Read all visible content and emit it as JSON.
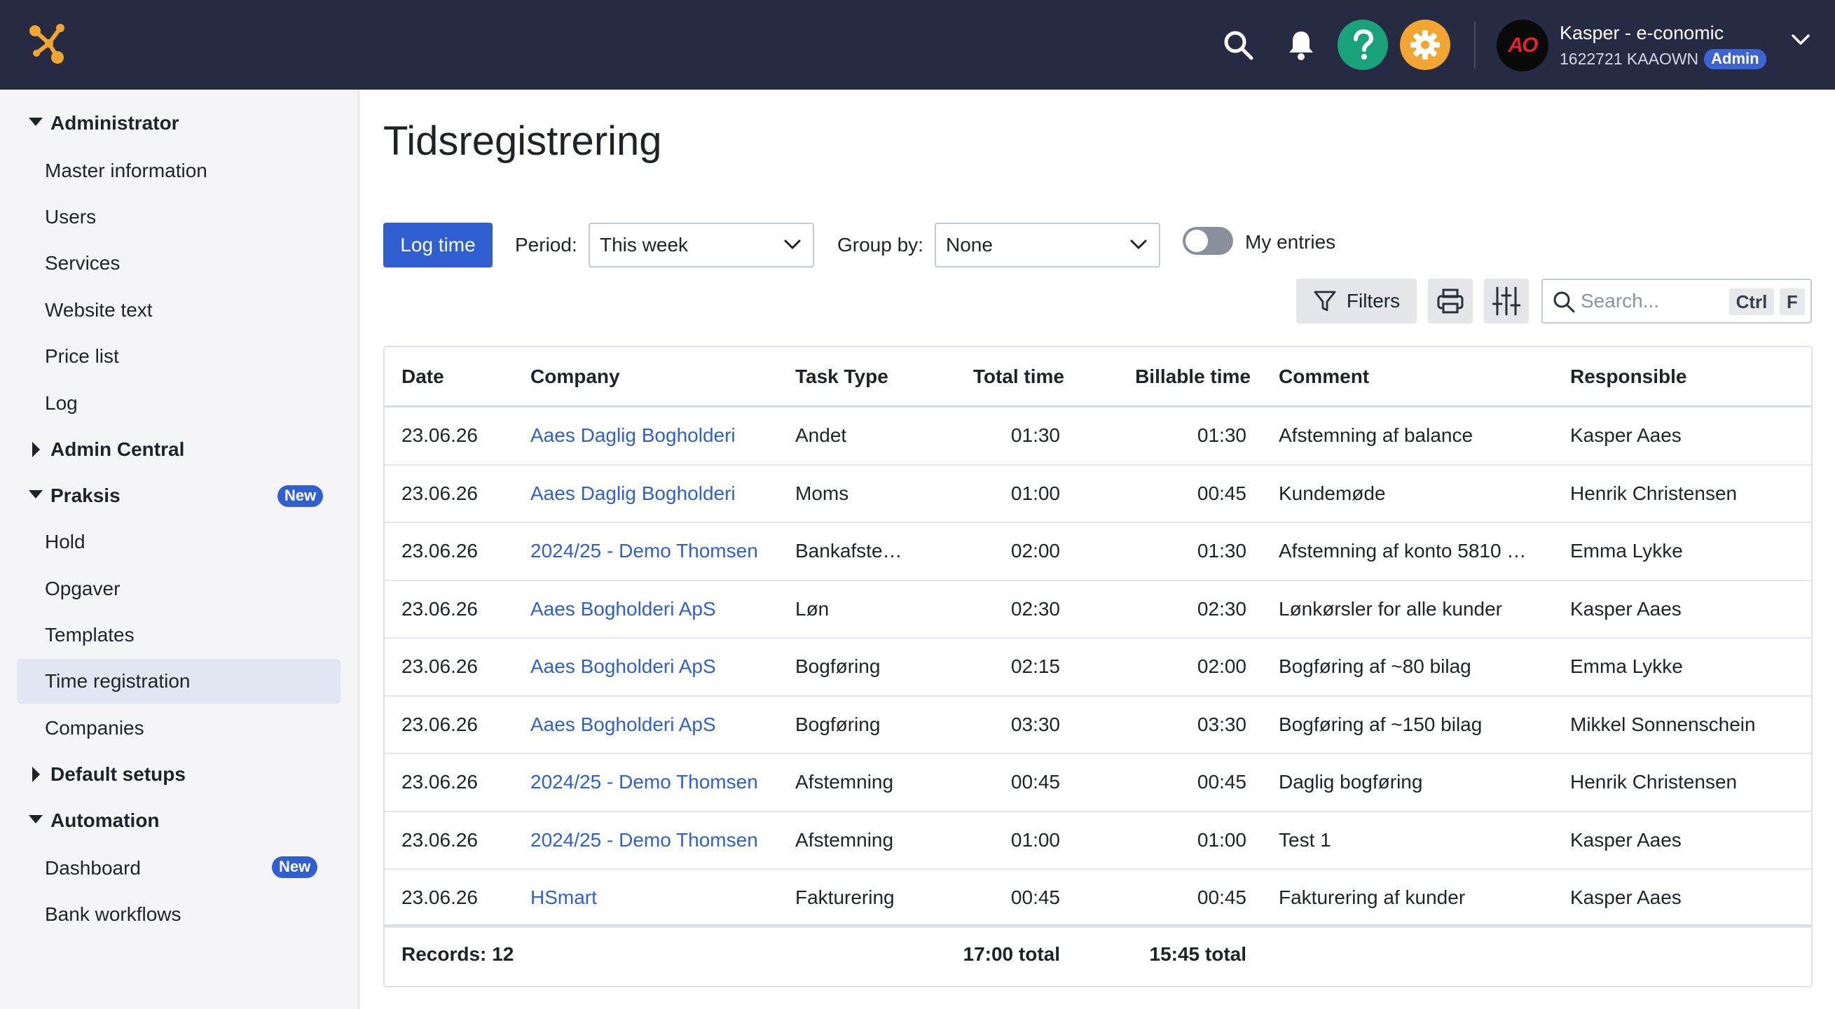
{
  "topbar": {
    "user_name": "Kasper - e-conomic",
    "user_account": "1622721 KAAOWN",
    "role_badge": "Admin",
    "avatar_text": "AO",
    "icons": [
      "logo-icon",
      "search-icon",
      "bell-icon",
      "help-icon",
      "settings-icon",
      "chevron-down-icon"
    ],
    "help_color": "#1aa37a",
    "settings_color": "#f2a531"
  },
  "sidebar": {
    "groups": {
      "administrator": "Administrator",
      "admin_central": "Admin Central",
      "praksis": "Praksis",
      "default_setups": "Default setups",
      "automation": "Automation"
    },
    "items": {
      "master_information": "Master information",
      "users": "Users",
      "services": "Services",
      "website_text": "Website text",
      "price_list": "Price list",
      "log": "Log",
      "hold": "Hold",
      "opgaver": "Opgaver",
      "templates": "Templates",
      "time_registration": "Time registration",
      "companies": "Companies",
      "dashboard": "Dashboard",
      "bank_workflows": "Bank workflows"
    },
    "new_badge": "New",
    "active_item": "Time registration"
  },
  "main": {
    "title": "Tidsregistrering",
    "log_time_label": "Log time",
    "period_label": "Period:",
    "period_value": "This week",
    "group_by_label": "Group by:",
    "group_by_value": "None",
    "my_entries_label": "My entries",
    "my_entries_on": false,
    "filters_label": "Filters",
    "search_placeholder": "Search...",
    "shortcut_ctrl": "Ctrl",
    "shortcut_f": "F"
  },
  "table": {
    "columns": [
      "Date",
      "Company",
      "Task Type",
      "Total time",
      "Billable time",
      "Comment",
      "Responsible"
    ],
    "rows": [
      [
        "23.06.26",
        "Aaes Daglig Bogholderi",
        "Andet",
        "01:30",
        "01:30",
        "Afstemning af balance",
        "Kasper Aaes"
      ],
      [
        "23.06.26",
        "Aaes Daglig Bogholderi",
        "Moms",
        "01:00",
        "00:45",
        "Kundemøde",
        "Henrik Christensen"
      ],
      [
        "23.06.26",
        "2024/25 - Demo Thomsen",
        "Bankafste…",
        "02:00",
        "01:30",
        "Afstemning af konto 5810 …",
        "Emma Lykke"
      ],
      [
        "23.06.26",
        "Aaes Bogholderi ApS",
        "Løn",
        "02:30",
        "02:30",
        "Lønkørsler for alle kunder",
        "Kasper Aaes"
      ],
      [
        "23.06.26",
        "Aaes Bogholderi ApS",
        "Bogføring",
        "02:15",
        "02:00",
        "Bogføring af ~80 bilag",
        "Emma Lykke"
      ],
      [
        "23.06.26",
        "Aaes Bogholderi ApS",
        "Bogføring",
        "03:30",
        "03:30",
        "Bogføring af ~150 bilag",
        "Mikkel Sonnenschein"
      ],
      [
        "23.06.26",
        "2024/25 - Demo Thomsen",
        "Afstemning",
        "00:45",
        "00:45",
        "Daglig bogføring",
        "Henrik Christensen"
      ],
      [
        "23.06.26",
        "2024/25 - Demo Thomsen",
        "Afstemning",
        "01:00",
        "01:00",
        "Test 1",
        "Kasper Aaes"
      ],
      [
        "23.06.26",
        "HSmart",
        "Fakturering",
        "00:45",
        "00:45",
        "Fakturering af kunder",
        "Kasper Aaes"
      ]
    ],
    "footer": {
      "records": "Records: 12",
      "total_time": "17:00 total",
      "billable_total": "15:45 total"
    }
  }
}
